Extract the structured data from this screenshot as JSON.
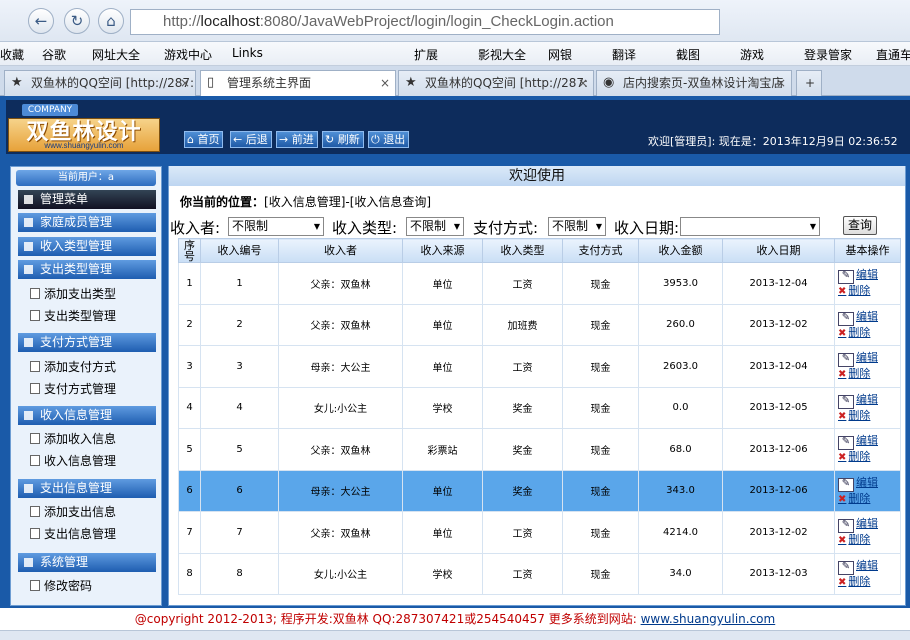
{
  "browser": {
    "url_prefix": "http://",
    "url_host": "localhost",
    "url_rest": ":8080/JavaWebProject/login/login_CheckLogin.action",
    "bookmarks": [
      "收藏",
      "谷歌",
      "网址大全",
      "游戏中心",
      "Links",
      "扩展",
      "影视大全",
      "网银",
      "翻译",
      "截图",
      "游戏",
      "登录管家",
      "直通车"
    ],
    "tabs": [
      {
        "label": "双鱼林的QQ空间 [http://287:",
        "active": false
      },
      {
        "label": "管理系统主界面",
        "active": true
      },
      {
        "label": "双鱼林的QQ空间 [http://287:",
        "active": false
      },
      {
        "label": "店内搜索页-双鱼林设计淘宝店",
        "active": false
      }
    ]
  },
  "header": {
    "company": "COMPANY",
    "logo_text": "双鱼林设计",
    "logo_url": "www.shuangyulin.com",
    "buttons": [
      "首页",
      "后退",
      "前进",
      "刷新",
      "退出"
    ],
    "welcome": "欢迎[管理员]:   现在是：2013年12月9日  02:36:52"
  },
  "sidebar": {
    "current_user": "当前用户：a",
    "menu_title": "管理菜单",
    "groups": [
      {
        "title": "家庭成员管理",
        "items": []
      },
      {
        "title": "收入类型管理",
        "items": []
      },
      {
        "title": "支出类型管理",
        "items": [
          "添加支出类型",
          "支出类型管理"
        ]
      },
      {
        "title": "支付方式管理",
        "items": [
          "添加支付方式",
          "支付方式管理"
        ]
      },
      {
        "title": "收入信息管理",
        "items": [
          "添加收入信息",
          "收入信息管理"
        ]
      },
      {
        "title": "支出信息管理",
        "items": [
          "添加支出信息",
          "支出信息管理"
        ]
      },
      {
        "title": "系统管理",
        "items": [
          "修改密码"
        ]
      }
    ]
  },
  "main": {
    "title": "欢迎使用",
    "position_label": "你当前的位置：",
    "position_path": "[收入信息管理]-[收入信息查询]",
    "filters": {
      "payer_label": "收入者:",
      "payer_value": "不限制",
      "type_label": "收入类型:",
      "type_value": "不限制",
      "pay_label": "支付方式:",
      "pay_value": "不限制",
      "date_label": "收入日期:",
      "date_value": "",
      "query_button": "查询"
    },
    "columns": [
      "序号",
      "收入编号",
      "收入者",
      "收入来源",
      "收入类型",
      "支付方式",
      "收入金额",
      "收入日期",
      "基本操作"
    ],
    "edit_label": "编辑",
    "delete_label": "删除",
    "rows": [
      [
        "1",
        "1",
        "父亲：双鱼林",
        "单位",
        "工资",
        "现金",
        "3953.0",
        "2013-12-04"
      ],
      [
        "2",
        "2",
        "父亲：双鱼林",
        "单位",
        "加班费",
        "现金",
        "260.0",
        "2013-12-02"
      ],
      [
        "3",
        "3",
        "母亲：大公主",
        "单位",
        "工资",
        "现金",
        "2603.0",
        "2013-12-04"
      ],
      [
        "4",
        "4",
        "女儿:小公主",
        "学校",
        "奖金",
        "现金",
        "0.0",
        "2013-12-05"
      ],
      [
        "5",
        "5",
        "父亲：双鱼林",
        "彩票站",
        "奖金",
        "现金",
        "68.0",
        "2013-12-06"
      ],
      [
        "6",
        "6",
        "母亲：大公主",
        "单位",
        "奖金",
        "现金",
        "343.0",
        "2013-12-06"
      ],
      [
        "7",
        "7",
        "父亲：双鱼林",
        "单位",
        "工资",
        "现金",
        "4214.0",
        "2013-12-02"
      ],
      [
        "8",
        "8",
        "女儿:小公主",
        "学校",
        "工资",
        "现金",
        "34.0",
        "2013-12-03"
      ]
    ],
    "highlight_row": 5
  },
  "footer": {
    "text": "@copyright 2012-2013; 程序开发:双鱼林  QQ:287307421或254540457  更多系统到网站: ",
    "link": "www.shuangyulin.com"
  }
}
